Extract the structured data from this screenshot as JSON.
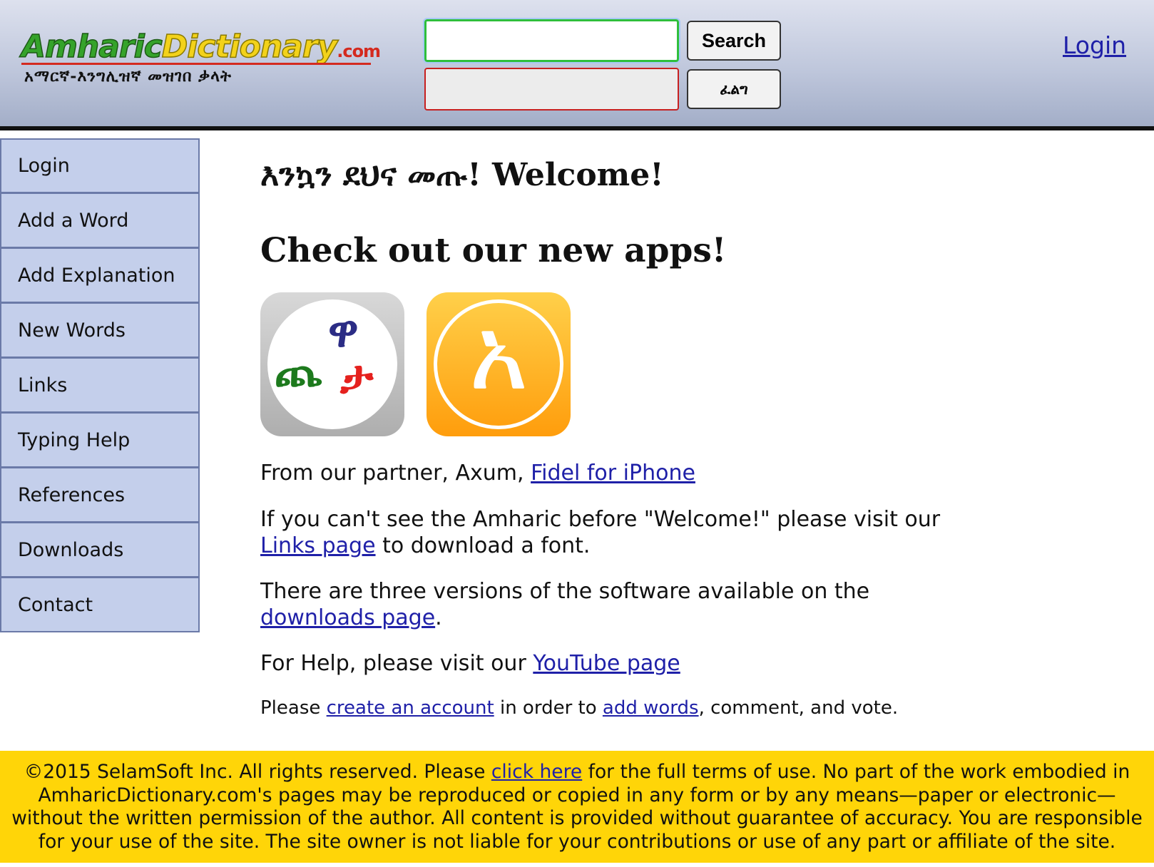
{
  "header": {
    "logo_part1": "Amharic",
    "logo_part2": "Dictionary",
    "logo_suffix": ".com",
    "logo_subtitle": "አማርኛ-እንግሊዝኛ መዝገበ ቃላት",
    "search_value": "",
    "amharic_value": "",
    "search_button": "Search",
    "amharic_button": "ፈልግ",
    "login_link": "Login"
  },
  "sidebar": {
    "items": [
      {
        "label": "Login"
      },
      {
        "label": "Add a Word"
      },
      {
        "label": "Add Explanation"
      },
      {
        "label": "New Words"
      },
      {
        "label": "Links"
      },
      {
        "label": "Typing Help"
      },
      {
        "label": "References"
      },
      {
        "label": "Downloads"
      },
      {
        "label": "Contact"
      }
    ]
  },
  "main": {
    "welcome_heading": "እንኳን ደህና መጡ! Welcome!",
    "apps_heading": "Check out our new apps!",
    "app1_glyph_green": "ጨ",
    "app1_glyph_blue": "ዋ",
    "app1_glyph_red": "ታ",
    "app2_glyph": "አ",
    "partner_text": "From our partner, Axum, ",
    "partner_link": "Fidel for iPhone",
    "font_text_1": "If you can't see the Amharic before \"Welcome!\" please visit our",
    "font_link": "Links page",
    "font_text_2": " to download a font.",
    "versions_text": "There are three versions of the software available on the",
    "versions_link": "downloads page",
    "versions_end": ".",
    "help_text": "For Help, please visit our ",
    "help_link": "YouTube page",
    "account_text_1": "Please ",
    "account_link": "create an account",
    "account_text_2": " in order to ",
    "addwords_link": "add words",
    "account_text_3": ", comment, and vote."
  },
  "footer": {
    "text_1": "©2015 SelamSoft Inc. All rights reserved. Please ",
    "terms_link": "click here",
    "text_2": " for the full terms of use. No part of the work embodied in AmharicDictionary.com's pages may be reproduced or copied in any form or by any means—paper or electronic—without the written permission of the author.  All content is provided without guarantee of accuracy.  You are responsible for your use of the site.  The site owner is not liable for your contributions or use of any part or affiliate of the site."
  }
}
